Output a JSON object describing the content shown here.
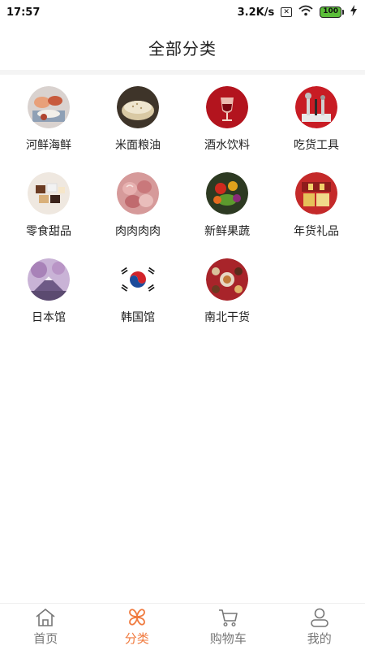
{
  "status_bar": {
    "time": "17:57",
    "speed": "3.2K/s",
    "sim_icon_glyph": "✕",
    "battery": "100"
  },
  "header": {
    "title": "全部分类"
  },
  "categories": [
    {
      "label": "河鲜海鲜",
      "icon": "seafood-icon"
    },
    {
      "label": "米面粮油",
      "icon": "grain-icon"
    },
    {
      "label": "酒水饮料",
      "icon": "wine-icon"
    },
    {
      "label": "吃货工具",
      "icon": "tools-icon"
    },
    {
      "label": "零食甜品",
      "icon": "snacks-icon"
    },
    {
      "label": "肉肉肉肉",
      "icon": "meat-icon"
    },
    {
      "label": "新鲜果蔬",
      "icon": "vegetables-icon"
    },
    {
      "label": "年货礼品",
      "icon": "gifts-icon"
    },
    {
      "label": "日本馆",
      "icon": "japan-icon"
    },
    {
      "label": "韩国馆",
      "icon": "korea-flag-icon"
    },
    {
      "label": "南北干货",
      "icon": "dried-goods-icon"
    }
  ],
  "tabbar": {
    "items": [
      {
        "label": "首页",
        "icon": "home-icon"
      },
      {
        "label": "分类",
        "icon": "category-icon"
      },
      {
        "label": "购物车",
        "icon": "cart-icon"
      },
      {
        "label": "我的",
        "icon": "profile-icon"
      }
    ],
    "active_index": 1,
    "active_color": "#f07a3e",
    "inactive_color": "#777777"
  }
}
